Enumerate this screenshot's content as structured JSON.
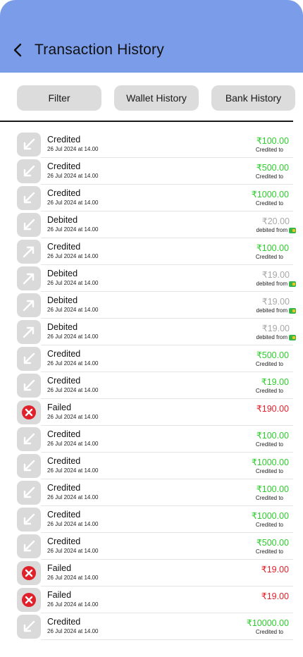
{
  "header": {
    "title": "Transaction History",
    "bg_color": "#7b9ce8"
  },
  "filters": {
    "filter": "Filter",
    "wallet": "Wallet History",
    "bank": "Bank History"
  },
  "colors": {
    "credit": "#2ecc2e",
    "debit": "#a8a8a8",
    "failed": "#e0202a"
  },
  "transactions": [
    {
      "status": "Credited",
      "date": "26 Jul 2024 at 14.00",
      "amount": "₹100.00",
      "sub": "Credited to",
      "kind": "credit",
      "icon": "arrow-down-left-icon"
    },
    {
      "status": "Credited",
      "date": "26 Jul 2024 at 14.00",
      "amount": "₹500.00",
      "sub": "Credited to",
      "kind": "credit",
      "icon": "arrow-down-left-icon"
    },
    {
      "status": "Credited",
      "date": "26 Jul 2024 at 14.00",
      "amount": "₹1000.00",
      "sub": "Credited to",
      "kind": "credit",
      "icon": "arrow-down-left-icon"
    },
    {
      "status": "Debited",
      "date": "26 Jul 2024 at 14.00",
      "amount": "₹20.00",
      "sub": "debited from",
      "kind": "debit",
      "icon": "arrow-down-left-icon"
    },
    {
      "status": "Credited",
      "date": "26 Jul 2024 at 14.00",
      "amount": "₹100.00",
      "sub": "Credited to",
      "kind": "credit",
      "icon": "arrow-up-right-icon"
    },
    {
      "status": "Debited",
      "date": "26 Jul 2024 at 14.00",
      "amount": "₹19.00",
      "sub": "debited from",
      "kind": "debit",
      "icon": "arrow-up-right-icon"
    },
    {
      "status": "Debited",
      "date": "26 Jul 2024 at 14.00",
      "amount": "₹19.00",
      "sub": "debited from",
      "kind": "debit",
      "icon": "arrow-up-right-icon"
    },
    {
      "status": "Debited",
      "date": "26 Jul 2024 at 14.00",
      "amount": "₹19.00",
      "sub": "debited from",
      "kind": "debit",
      "icon": "arrow-up-right-icon"
    },
    {
      "status": "Credited",
      "date": "26 Jul 2024 at 14.00",
      "amount": "₹500.00",
      "sub": "Credited to",
      "kind": "credit",
      "icon": "arrow-down-left-icon"
    },
    {
      "status": "Credited",
      "date": "26 Jul 2024 at 14.00",
      "amount": "₹19.00",
      "sub": "Credited to",
      "kind": "credit",
      "icon": "arrow-down-left-icon"
    },
    {
      "status": "Failed",
      "date": "26 Jul 2024 at 14.00",
      "amount": "₹190.00",
      "sub": "",
      "kind": "failed",
      "icon": "failed-x-icon"
    },
    {
      "status": "Credited",
      "date": "26 Jul 2024 at 14.00",
      "amount": "₹100.00",
      "sub": "Credited to",
      "kind": "credit",
      "icon": "arrow-down-left-icon"
    },
    {
      "status": "Credited",
      "date": "26 Jul 2024 at 14.00",
      "amount": "₹1000.00",
      "sub": "Credited to",
      "kind": "credit",
      "icon": "arrow-down-left-icon"
    },
    {
      "status": "Credited",
      "date": "26 Jul 2024 at 14.00",
      "amount": "₹100.00",
      "sub": "Credited to",
      "kind": "credit",
      "icon": "arrow-down-left-icon"
    },
    {
      "status": "Credited",
      "date": "26 Jul 2024 at 14.00",
      "amount": "₹1000.00",
      "sub": "Credited to",
      "kind": "credit",
      "icon": "arrow-down-left-icon"
    },
    {
      "status": "Credited",
      "date": "26 Jul 2024 at 14.00",
      "amount": "₹500.00",
      "sub": "Credited to",
      "kind": "credit",
      "icon": "arrow-down-left-icon"
    },
    {
      "status": "Failed",
      "date": "26 Jul 2024 at 14.00",
      "amount": "₹19.00",
      "sub": "",
      "kind": "failed",
      "icon": "failed-x-icon"
    },
    {
      "status": "Failed",
      "date": "26 Jul 2024 at 14.00",
      "amount": "₹19.00",
      "sub": "",
      "kind": "failed",
      "icon": "failed-x-icon"
    },
    {
      "status": "Credited",
      "date": "26 Jul 2024 at 14.00",
      "amount": "₹10000.00",
      "sub": "Credited to",
      "kind": "credit",
      "icon": "arrow-down-left-icon"
    }
  ]
}
